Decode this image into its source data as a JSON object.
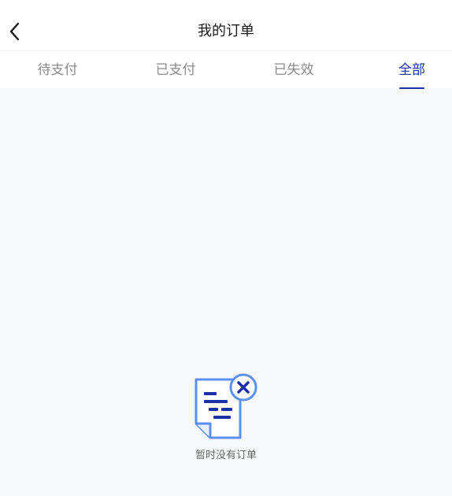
{
  "header": {
    "title": "我的订单",
    "back_icon": "chevron-left-icon"
  },
  "tabs": [
    {
      "label": "待支付",
      "active": false
    },
    {
      "label": "已支付",
      "active": false
    },
    {
      "label": "已失效",
      "active": false
    },
    {
      "label": "全部",
      "active": true
    }
  ],
  "empty_state": {
    "icon": "empty-order-icon",
    "message": "暂时没有订单"
  },
  "colors": {
    "accent": "#1b2fa8",
    "icon_light": "#5b8ff0",
    "icon_dark": "#1b2fa8",
    "background": "#f7f8fa"
  }
}
